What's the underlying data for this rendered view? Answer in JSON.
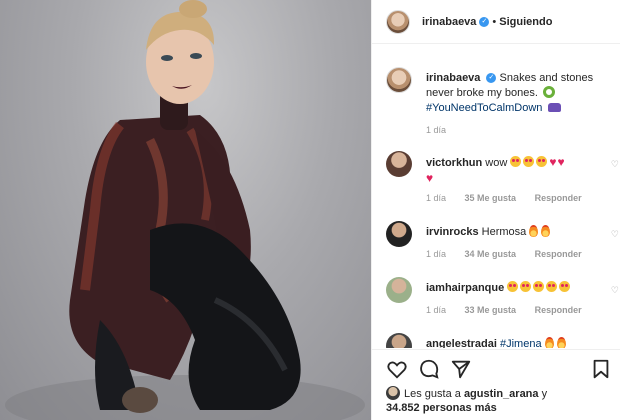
{
  "header": {
    "username": "irinabaeva",
    "separator": "•",
    "follow_status": "Siguiendo"
  },
  "caption": {
    "username": "irinabaeva",
    "text": "Snakes and stones never broke my bones.",
    "hashtag": "#YouNeedToCalmDown",
    "time": "1 día"
  },
  "comments": [
    {
      "username": "victorkhun",
      "text": "wow",
      "emojis": [
        "heart-eyes",
        "heart-eyes",
        "heart-eyes",
        "heart",
        "heart",
        "heart"
      ],
      "time": "1 día",
      "likes": "35 Me gusta",
      "reply": "Responder"
    },
    {
      "username": "irvinrocks",
      "text": "Hermosa",
      "emojis": [
        "fire",
        "fire"
      ],
      "time": "1 día",
      "likes": "34 Me gusta",
      "reply": "Responder"
    },
    {
      "username": "iamhairpanque",
      "text": "",
      "emojis": [
        "heart-eyes",
        "heart-eyes",
        "heart-eyes",
        "heart-eyes",
        "heart-eyes"
      ],
      "time": "1 día",
      "likes": "33 Me gusta",
      "reply": "Responder"
    },
    {
      "username": "angelestradai",
      "text": "#Jimena",
      "emojis": [
        "fire",
        "fire"
      ]
    }
  ],
  "likes": {
    "prefix": "Les gusta a",
    "user": "agustin_arana",
    "connector": "y",
    "count": "34.852 personas más"
  },
  "colors": {
    "verified": "#3897f0",
    "hashtag": "#003569",
    "meta_gray": "#999999",
    "heart_red": "#e0245e"
  }
}
